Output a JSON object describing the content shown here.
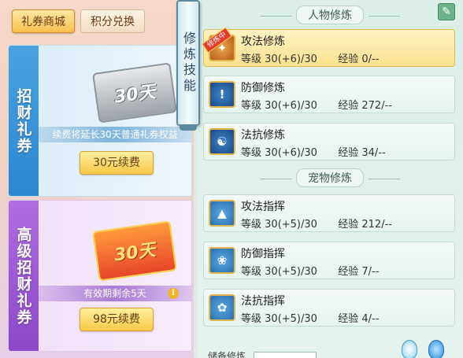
{
  "shop": {
    "tabs": [
      {
        "label": "礼券商城",
        "active": true
      },
      {
        "label": "积分兑换",
        "active": false
      }
    ],
    "cards": [
      {
        "side_title": "招财礼券",
        "voucher_text": "30天",
        "note": "续费将延长30天普通礼券权益",
        "button": "30元续费"
      },
      {
        "side_title": "高级招财礼券",
        "voucher_text": "30天",
        "note": "有效期剩余5天",
        "button": "98元续费"
      }
    ]
  },
  "scroll_tab": {
    "label": "修炼技能"
  },
  "skills": {
    "sections": [
      {
        "title": "人物修炼",
        "rows": [
          {
            "name": "攻法修炼",
            "level_label": "等级",
            "level": "30(+6)/30",
            "exp_label": "经验",
            "exp": "0/--",
            "ribbon": "修炼中",
            "icon": "fire-claw-icon",
            "selected": true
          },
          {
            "name": "防御修炼",
            "level_label": "等级",
            "level": "30(+6)/30",
            "exp_label": "经验",
            "exp": "272/--",
            "icon": "shield-icon"
          },
          {
            "name": "法抗修炼",
            "level_label": "等级",
            "level": "30(+6)/30",
            "exp_label": "经验",
            "exp": "34/--",
            "icon": "yin-yang-shield-icon"
          }
        ]
      },
      {
        "title": "宠物修炼",
        "rows": [
          {
            "name": "攻法指挥",
            "level_label": "等级",
            "level": "30(+5)/30",
            "exp_label": "经验",
            "exp": "212/--",
            "icon": "pizza-slice-icon"
          },
          {
            "name": "防御指挥",
            "level_label": "等级",
            "level": "30(+5)/30",
            "exp_label": "经验",
            "exp": "7/--",
            "icon": "paw-icon"
          },
          {
            "name": "法抗指挥",
            "level_label": "等级",
            "level": "30(+5)/30",
            "exp_label": "经验",
            "exp": "4/--",
            "icon": "paw-shield-icon"
          }
        ]
      }
    ],
    "bottom_label": "储备修炼"
  }
}
